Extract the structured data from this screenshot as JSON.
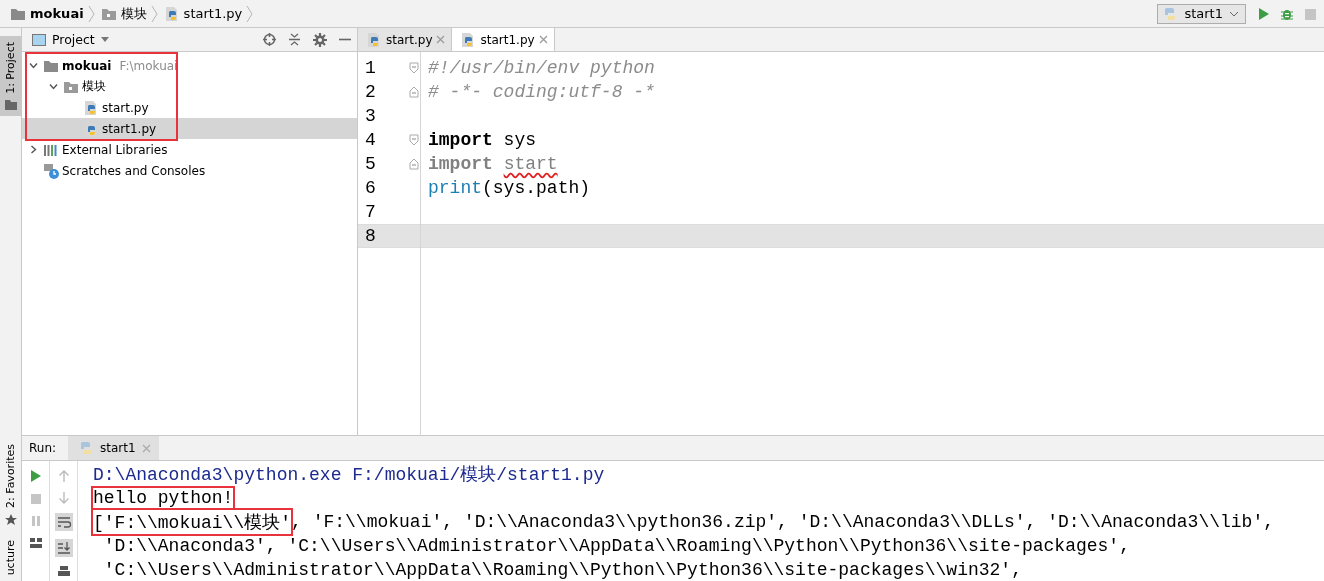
{
  "breadcrumbs": [
    {
      "label": "mokuai",
      "kind": "project"
    },
    {
      "label": "模块",
      "kind": "package"
    },
    {
      "label": "start1.py",
      "kind": "python"
    }
  ],
  "run_config": {
    "label": "start1"
  },
  "side_tabs_top": [
    {
      "label": "1: Project",
      "selected": true
    }
  ],
  "side_tabs_bottom": [
    {
      "label": "2: Favorites",
      "selected": false
    },
    {
      "label": "ucture",
      "selected": false
    }
  ],
  "project_panel": {
    "title": "Project",
    "annotated": true,
    "tree": [
      {
        "label": "mokuai",
        "path": "F:\\mokuai",
        "kind": "project",
        "expanded": true,
        "selected": false,
        "children": [
          {
            "label": "模块",
            "kind": "package",
            "expanded": true,
            "selected": false,
            "children": [
              {
                "label": "start.py",
                "kind": "python",
                "selected": false
              },
              {
                "label": "start1.py",
                "kind": "python",
                "selected": true
              }
            ]
          }
        ]
      },
      {
        "label": "External Libraries",
        "kind": "libraries",
        "expanded": false,
        "selected": false
      },
      {
        "label": "Scratches and Consoles",
        "kind": "scratches",
        "selected": false
      }
    ]
  },
  "editor_tabs": [
    {
      "label": "start.py",
      "selected": false
    },
    {
      "label": "start1.py",
      "selected": true
    }
  ],
  "code_lines": [
    {
      "number": "1",
      "fold_start": true,
      "current": false,
      "tokens": [
        {
          "text": "#!/usr/bin/env python",
          "kind": "comment"
        }
      ]
    },
    {
      "number": "2",
      "fold_end": true,
      "current": false,
      "tokens": [
        {
          "text": "# -*- coding:utf-8 -*",
          "kind": "comment"
        }
      ]
    },
    {
      "number": "3",
      "current": false
    },
    {
      "number": "4",
      "fold_start": true,
      "current": false,
      "tokens": [
        {
          "text": "import",
          "kind": "keyword"
        },
        {
          "text": " sys",
          "kind": "plain"
        }
      ]
    },
    {
      "number": "5",
      "fold_end": true,
      "current": false,
      "tokens": [
        {
          "text": "import ",
          "kind": "unused"
        },
        {
          "text": "start",
          "kind": "unresolved"
        }
      ]
    },
    {
      "number": "6",
      "current": false,
      "tokens": [
        {
          "text": "print",
          "kind": "builtin"
        },
        {
          "text": "(sys.path)",
          "kind": "plain"
        }
      ]
    },
    {
      "number": "7",
      "current": false
    },
    {
      "number": "8",
      "current": true
    }
  ],
  "run_panel": {
    "label": "Run:",
    "tabs": [
      {
        "label": "start1",
        "selected": true
      }
    ],
    "output": [
      {
        "kind": "command",
        "segments": [
          {
            "text": "D:\\Anaconda3\\python.exe F:/mokuai/模块/start1.py",
            "boxed": false
          }
        ]
      },
      {
        "kind": "stdout",
        "segments": [
          {
            "text": "hello python!",
            "boxed": true
          }
        ]
      },
      {
        "kind": "stdout",
        "segments": [
          {
            "text": "['F:\\\\mokuai\\\\模块'",
            "boxed": true
          },
          {
            "text": ", 'F:\\\\mokuai', 'D:\\\\Anaconda3\\\\python36.zip', 'D:\\\\Anaconda3\\\\DLLs', 'D:\\\\Anaconda3\\\\lib',",
            "boxed": false
          }
        ]
      },
      {
        "kind": "stdout",
        "segments": [
          {
            "text": " 'D:\\\\Anaconda3', 'C:\\\\Users\\\\Administrator\\\\AppData\\\\Roaming\\\\Python\\\\Python36\\\\site-packages',",
            "boxed": false
          }
        ]
      },
      {
        "kind": "stdout",
        "segments": [
          {
            "text": " 'C:\\\\Users\\\\Administrator\\\\AppData\\\\Roaming\\\\Python\\\\Python36\\\\site-packages\\\\win32',",
            "boxed": false
          }
        ]
      }
    ]
  }
}
